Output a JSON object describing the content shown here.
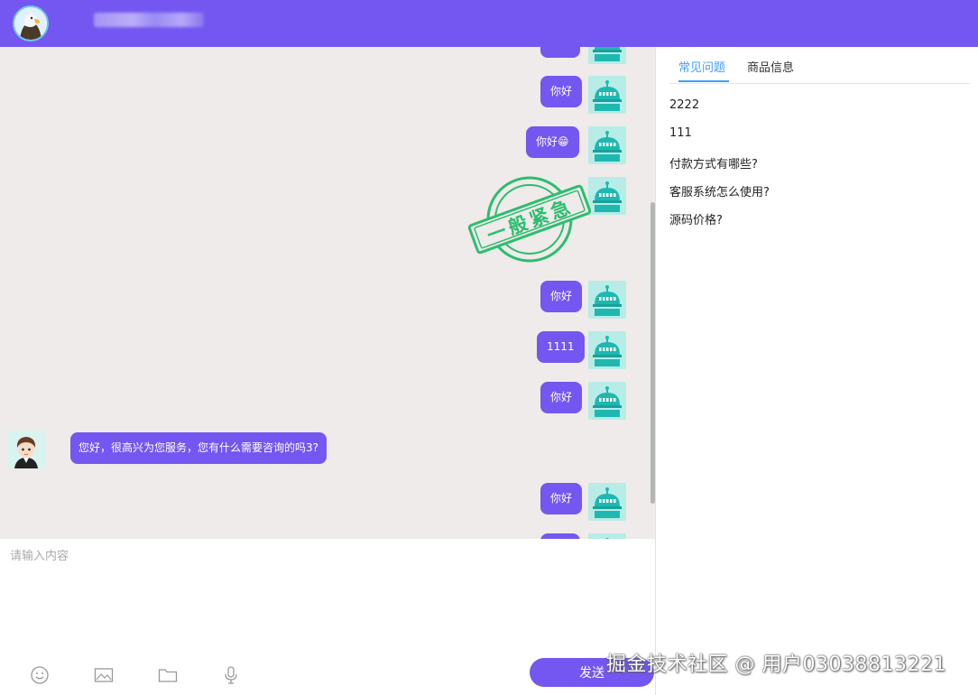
{
  "colors": {
    "brand": "#7357f0",
    "chat_bg": "#eeebea",
    "tab_active": "#409eff",
    "stamp": "#2cbd6e",
    "robot": "#1fb8b0"
  },
  "header": {
    "avatar_icon": "eagle-avatar"
  },
  "messages": [
    {
      "side": "right",
      "text": "你好"
    },
    {
      "side": "right",
      "text": "你好😁"
    },
    {
      "side": "right",
      "text": "",
      "stamp_text": "一般紧急"
    },
    {
      "side": "right",
      "text": "你好"
    },
    {
      "side": "right",
      "text": "1111"
    },
    {
      "side": "right",
      "text": "你好"
    },
    {
      "side": "left",
      "text": "您好，很高兴为您服务，您有什么需要咨询的吗3?"
    },
    {
      "side": "right",
      "text": "你好"
    }
  ],
  "input": {
    "placeholder": "请输入内容",
    "value": ""
  },
  "toolbar": {
    "icons": [
      "emoji-icon",
      "image-icon",
      "folder-icon",
      "microphone-icon"
    ],
    "send_label": "发送"
  },
  "sidebar": {
    "tabs": [
      {
        "label": "常见问题",
        "active": true
      },
      {
        "label": "商品信息",
        "active": false
      }
    ],
    "faq": [
      "2222",
      "111",
      "付款方式有哪些?",
      "客服系统怎么使用?",
      "源码价格?"
    ]
  },
  "watermark": "掘金技术社区 @ 用户03038813221"
}
